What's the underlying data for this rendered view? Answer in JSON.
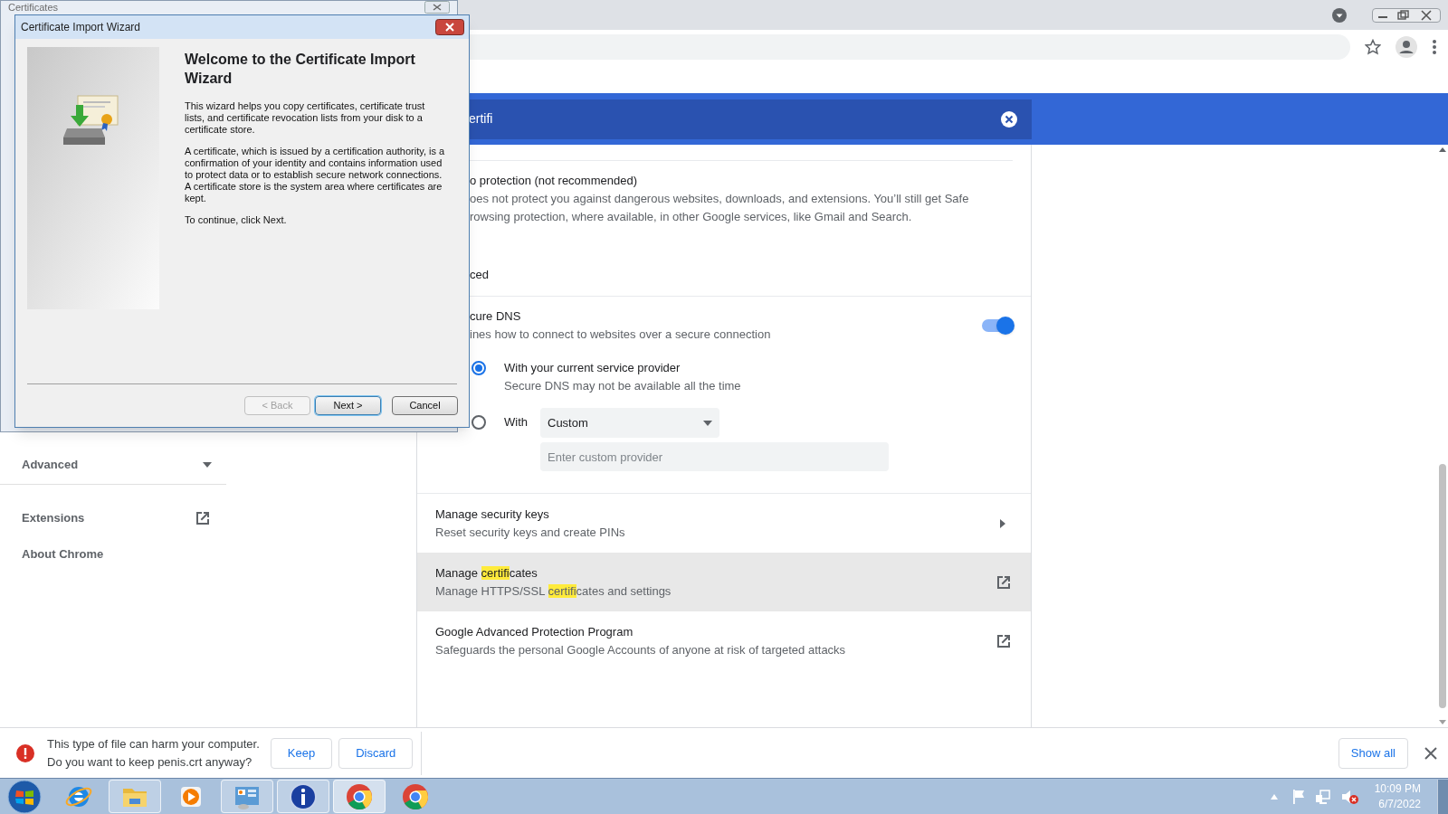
{
  "certificates_window": {
    "title": "Certificates"
  },
  "wizard": {
    "title": "Certificate Import Wizard",
    "heading": "Welcome to the Certificate Import Wizard",
    "paragraphs": [
      "This wizard helps you copy certificates, certificate trust lists, and certificate revocation lists from your disk to a certificate store.",
      "A certificate, which is issued by a certification authority, is a confirmation of your identity and contains information used to protect data or to establish secure network connections. A certificate store is the system area where certificates are kept.",
      "To continue, click Next."
    ],
    "buttons": [
      {
        "label": "< Back",
        "disabled": true,
        "focused": false
      },
      {
        "label": "Next >",
        "disabled": false,
        "focused": true
      },
      {
        "label": "Cancel",
        "disabled": false,
        "focused": false
      }
    ]
  },
  "search": {
    "value": "ertifi"
  },
  "sidebar": {
    "items": [
      {
        "label": "Advanced",
        "kind": "expander"
      },
      {
        "label": "Extensions",
        "kind": "external"
      },
      {
        "label": "About Chrome",
        "kind": "plain"
      }
    ]
  },
  "settings": {
    "option": {
      "title": "o protection (not recommended)",
      "description": [
        "oes not protect you against dangerous websites, downloads, and extensions. You’ll still get Safe",
        "rowsing protection, where available, in other Google services, like Gmail and Search."
      ]
    },
    "section_heading": "ced",
    "secure_dns": {
      "title": "cure DNS",
      "description": "ines how to connect to websites over a secure connection",
      "on": true,
      "options": [
        {
          "kind": "radio",
          "label": "With your current service provider",
          "description": "Secure DNS may not be available all the time",
          "selected": true
        },
        {
          "kind": "custom",
          "label": "With",
          "selected": false,
          "dropdown": "Custom",
          "placeholder": "Enter custom provider"
        }
      ]
    },
    "rows": [
      {
        "kind": "arrow",
        "highlighted": false,
        "title": [
          {
            "text": "Manage security keys",
            "match": false
          }
        ],
        "description": [
          {
            "text": "Reset security keys and create PINs",
            "match": false
          }
        ]
      },
      {
        "kind": "external",
        "highlighted": true,
        "title": [
          {
            "text": "Manage ",
            "match": false
          },
          {
            "text": "certifi",
            "match": true
          },
          {
            "text": "cates",
            "match": false
          }
        ],
        "description": [
          {
            "text": "Manage HTTPS/SSL ",
            "match": false
          },
          {
            "text": "certifi",
            "match": true
          },
          {
            "text": "cates and settings",
            "match": false
          }
        ]
      },
      {
        "kind": "external",
        "highlighted": false,
        "title": [
          {
            "text": "Google Advanced Protection Program",
            "match": false
          }
        ],
        "description": [
          {
            "text": "Safeguards the personal Google Accounts of anyone at risk of targeted attacks",
            "match": false
          }
        ]
      }
    ]
  },
  "download_bar": {
    "message": [
      "This type of file can harm your computer.",
      "Do you want to keep penis.crt anyway?"
    ],
    "buttons": [
      "Keep",
      "Discard"
    ],
    "show_all": "Show all"
  },
  "taskbar": {
    "apps": [
      {
        "kind": "ie",
        "running": false,
        "active": false
      },
      {
        "kind": "explorer",
        "running": true,
        "active": false
      },
      {
        "kind": "media",
        "running": false,
        "active": false
      },
      {
        "kind": "control_panel",
        "running": true,
        "active": false
      },
      {
        "kind": "info",
        "running": true,
        "active": false
      },
      {
        "kind": "chrome",
        "running": true,
        "active": true
      },
      {
        "kind": "chrome",
        "running": false,
        "active": false
      }
    ],
    "clock": {
      "time": "10:09 PM",
      "date": "6/7/2022"
    }
  }
}
